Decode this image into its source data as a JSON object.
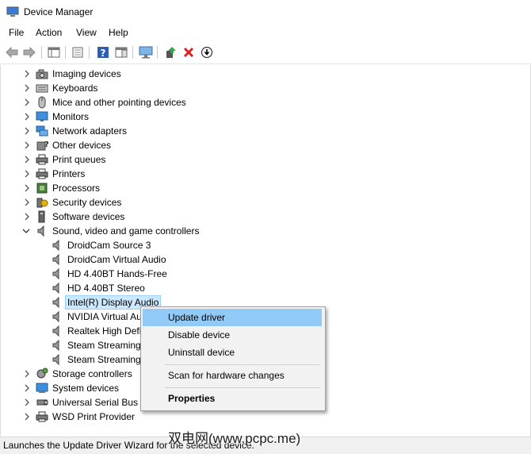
{
  "window": {
    "title": "Device Manager"
  },
  "menu": [
    "File",
    "Action",
    "View",
    "Help"
  ],
  "tree": [
    {
      "label": "Imaging devices",
      "icon": "camera-icon",
      "expanded": false
    },
    {
      "label": "Keyboards",
      "icon": "keyboard-icon",
      "expanded": false
    },
    {
      "label": "Mice and other pointing devices",
      "icon": "mouse-icon",
      "expanded": false
    },
    {
      "label": "Monitors",
      "icon": "monitor-icon",
      "expanded": false
    },
    {
      "label": "Network adapters",
      "icon": "network-icon",
      "expanded": false
    },
    {
      "label": "Other devices",
      "icon": "unknown-device-icon",
      "expanded": false
    },
    {
      "label": "Print queues",
      "icon": "print-queue-icon",
      "expanded": false
    },
    {
      "label": "Printers",
      "icon": "printer-icon",
      "expanded": false
    },
    {
      "label": "Processors",
      "icon": "processor-icon",
      "expanded": false
    },
    {
      "label": "Security devices",
      "icon": "security-icon",
      "expanded": false
    },
    {
      "label": "Software devices",
      "icon": "software-device-icon",
      "expanded": false
    },
    {
      "label": "Sound, video and game controllers",
      "icon": "speaker-icon",
      "expanded": true,
      "children": [
        "DroidCam Source 3",
        "DroidCam Virtual Audio",
        "HD 4.40BT Hands-Free",
        "HD 4.40BT Stereo",
        "Intel(R) Display Audio",
        "NVIDIA Virtual Au",
        "Realtek High Defi",
        "Steam Streaming",
        "Steam Streaming"
      ],
      "selected_child": "Intel(R) Display Audio"
    },
    {
      "label": "Storage controllers",
      "icon": "storage-icon",
      "expanded": false
    },
    {
      "label": "System devices",
      "icon": "system-device-icon",
      "expanded": false
    },
    {
      "label": "Universal Serial Bus c",
      "icon": "usb-icon",
      "expanded": false
    },
    {
      "label": "WSD Print Provider",
      "icon": "printer-icon",
      "expanded": false
    }
  ],
  "context_menu": {
    "items": [
      "Update driver",
      "Disable device",
      "Uninstall device",
      "Scan for hardware changes",
      "Properties"
    ],
    "highlighted": "Update driver"
  },
  "status": "Launches the Update Driver Wizard for the selected device.",
  "watermark": "双电网(www.pcpc.me)",
  "colors": {
    "selection": "#cce8ff",
    "menu_highlight": "#91c9f7"
  }
}
